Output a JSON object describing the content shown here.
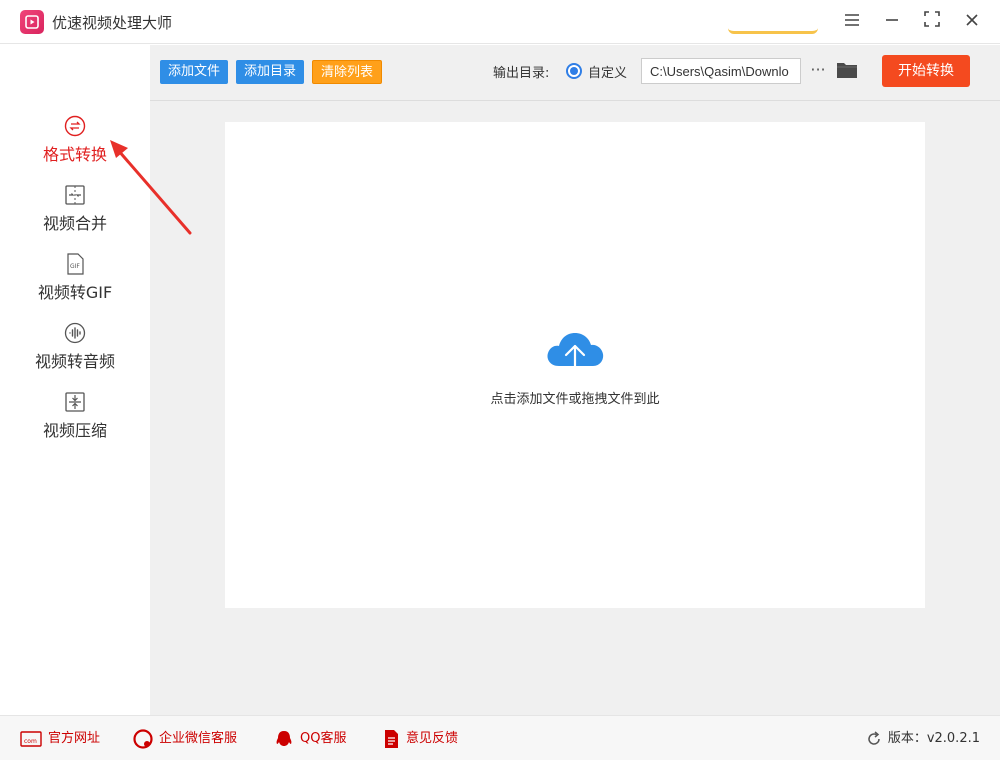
{
  "app": {
    "title": "优速视频处理大师"
  },
  "window": {
    "menu_icon": "hamburger-icon",
    "maximize_icon": "maximize-icon",
    "close_icon": "close-icon"
  },
  "sidebar": {
    "items": [
      {
        "label": "格式转换",
        "icon": "format-convert-icon",
        "active": true
      },
      {
        "label": "视频合并",
        "icon": "video-merge-icon",
        "active": false
      },
      {
        "label": "视频转GIF",
        "icon": "gif-icon",
        "active": false
      },
      {
        "label": "视频转音频",
        "icon": "audio-icon",
        "active": false
      },
      {
        "label": "视频压缩",
        "icon": "compress-icon",
        "active": false
      }
    ]
  },
  "toolbar": {
    "add_file": "添加文件",
    "add_folder": "添加目录",
    "clear_list": "清除列表",
    "output_label": "输出目录:",
    "custom_label": "自定义",
    "path_value": "C:\\Users\\Qasim\\Downlo",
    "more": "···",
    "start": "开始转换"
  },
  "dropzone": {
    "text": "点击添加文件或拖拽文件到此"
  },
  "footer": {
    "website": "官方网址",
    "wechat": "企业微信客服",
    "qq": "QQ客服",
    "feedback": "意见反馈",
    "version": "版本：v2.0.2.1"
  },
  "colors": {
    "accent_blue": "#2f8ee6",
    "accent_orange": "#ffa01a",
    "start_red": "#f44a1f",
    "active_red": "#e02020"
  }
}
